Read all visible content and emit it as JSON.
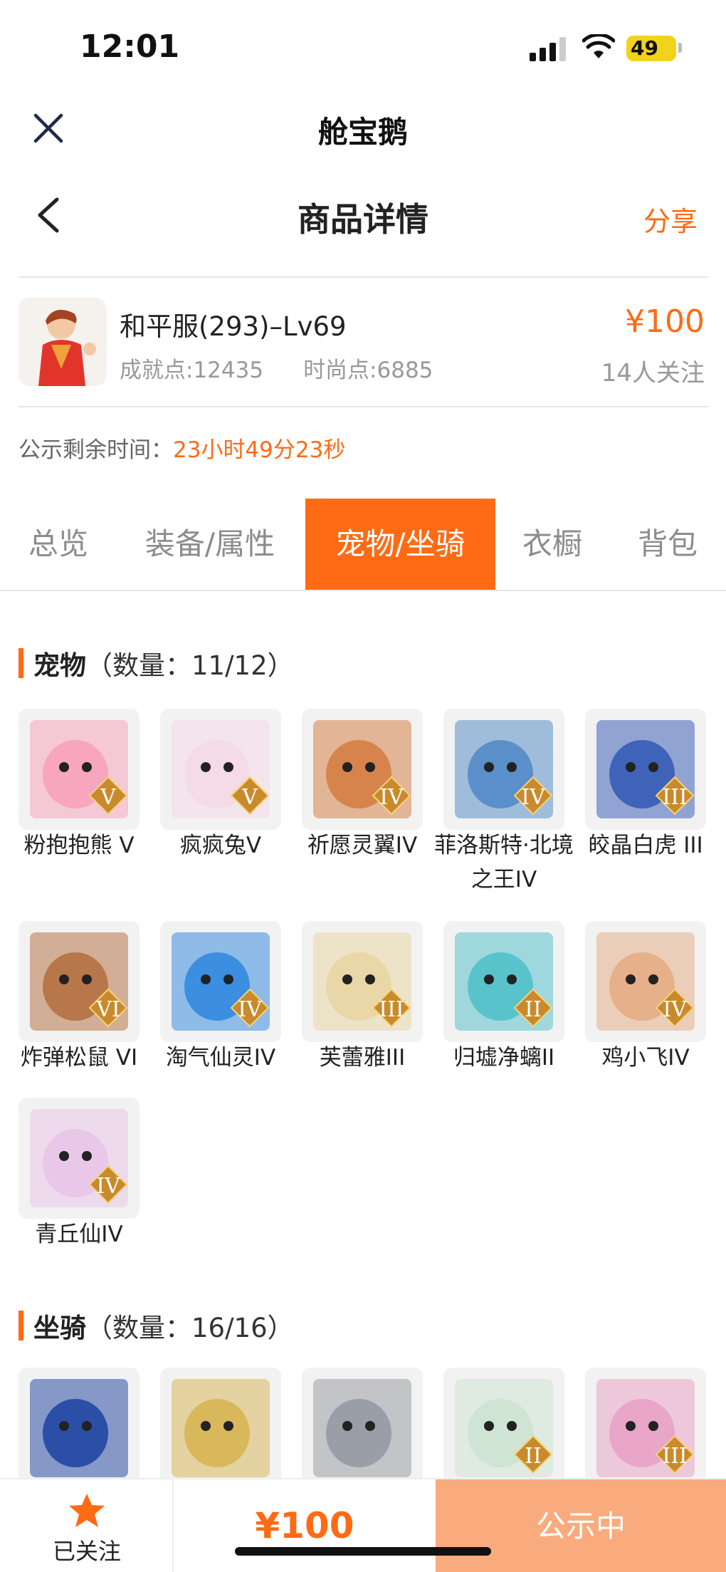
{
  "status_bar": {
    "time": "12:01",
    "battery": "49"
  },
  "header": {
    "app_title": "舱宝鹅",
    "page_title": "商品详情",
    "share_label": "分享"
  },
  "product": {
    "name": "和平服(293)–Lv69",
    "achievement": "成就点:12435",
    "fashion": "时尚点:6885",
    "price": "¥100",
    "followers": "14人关注",
    "countdown_label": "公示剩余时间：",
    "countdown_value": "23小时49分23秒"
  },
  "tabs": [
    {
      "label": "总览"
    },
    {
      "label": "装备/属性"
    },
    {
      "label": "宠物/坐骑",
      "active": true
    },
    {
      "label": "衣橱"
    },
    {
      "label": "背包"
    }
  ],
  "pets": {
    "title": "宠物",
    "count": "（数量：11/12）",
    "items": [
      {
        "name": "粉抱抱熊 V",
        "rank": "V",
        "color": "#f7a6bd"
      },
      {
        "name": "疯疯兔V",
        "rank": "V",
        "color": "#f4dbe6"
      },
      {
        "name": "祈愿灵翼IV",
        "rank": "IV",
        "color": "#d7844c"
      },
      {
        "name": "菲洛斯特·北境之王IV",
        "rank": "IV",
        "color": "#5b8fc9"
      },
      {
        "name": "皎晶白虎 III",
        "rank": "III",
        "color": "#3f63b8"
      },
      {
        "name": "炸弹松鼠 VI",
        "rank": "VI",
        "color": "#b8774a"
      },
      {
        "name": "淘气仙灵IV",
        "rank": "IV",
        "color": "#3c8ee0"
      },
      {
        "name": "芙蕾雅III",
        "rank": "III",
        "color": "#e9d7a8"
      },
      {
        "name": "归墟净螭II",
        "rank": "II",
        "color": "#59c3cc"
      },
      {
        "name": "鸡小飞IV",
        "rank": "IV",
        "color": "#e6b08a"
      },
      {
        "name": "青丘仙IV",
        "rank": "IV",
        "color": "#e9c7e8"
      }
    ]
  },
  "mounts": {
    "title": "坐骑",
    "count": "（数量：16/16）",
    "items": [
      {
        "rank": "",
        "color": "#2b4fa6"
      },
      {
        "rank": "",
        "color": "#d9b85c"
      },
      {
        "rank": "",
        "color": "#9a9ea6"
      },
      {
        "rank": "II",
        "color": "#cfe4d2"
      },
      {
        "rank": "III",
        "color": "#e9a6c8"
      }
    ]
  },
  "bottom_bar": {
    "follow_label": "已关注",
    "price": "¥100",
    "status": "公示中"
  },
  "colors": {
    "accent": "#ff6a14",
    "status_button": "#f9ab7e"
  }
}
